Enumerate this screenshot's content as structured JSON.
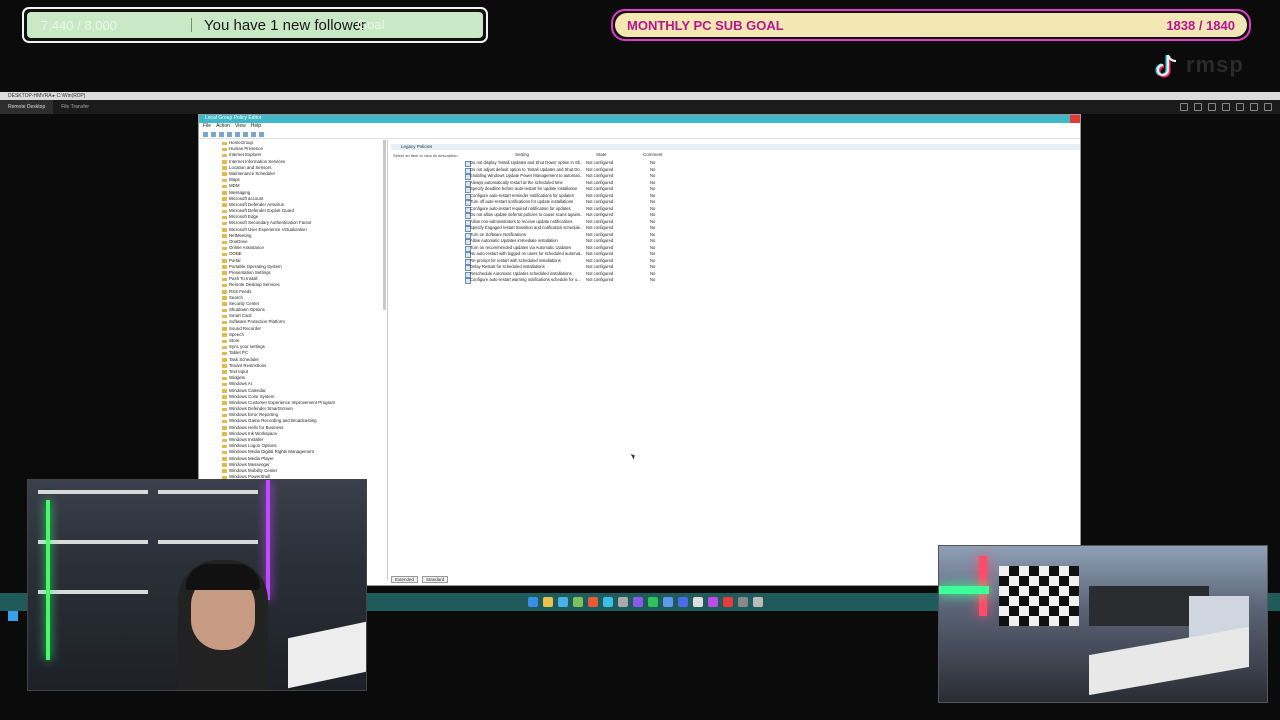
{
  "alert": {
    "ghost_left": "7,440 / 8,000",
    "message": "You have 1 new follower",
    "ghost_right": "Goal"
  },
  "goal": {
    "title": "MONTHLY PC SUB GOAL",
    "count": "1838 / 1840"
  },
  "brand": {
    "icon": "tiktok-icon",
    "text": "rmsp"
  },
  "remote_desktop": {
    "title": "DESKTOP-HMVRA ▸ C:\\Win(RDP)",
    "tabs": [
      "Remote Desktop",
      "File Transfer"
    ]
  },
  "gpedit": {
    "title": "Local Group Policy Editor",
    "menu": [
      "File",
      "Action",
      "View",
      "Help"
    ],
    "breadcrumb": "Legacy Policies",
    "hint": "Select an item to view its description.",
    "columns": {
      "setting": "Setting",
      "state": "State",
      "comment": "Comment"
    },
    "tree": [
      "HomeGroup",
      "Human Presence",
      "Internet Explorer",
      "Internet Information Services",
      "Location and Sensors",
      "Maintenance Scheduler",
      "Maps",
      "MDM",
      "Messaging",
      "Microsoft account",
      "Microsoft Defender Antivirus",
      "Microsoft Defender Exploit Guard",
      "Microsoft Edge",
      "Microsoft Secondary Authentication Factor",
      "Microsoft User Experience Virtualization",
      "NetMeeting",
      "OneDrive",
      "Online Assistance",
      "OOBE",
      "Portal",
      "Portable Operating System",
      "Presentation Settings",
      "Push To Install",
      "Remote Desktop Services",
      "RSS Feeds",
      "Search",
      "Security Center",
      "Shutdown Options",
      "Smart Card",
      "Software Protection Platform",
      "Sound Recorder",
      "Speech",
      "Store",
      "Sync your settings",
      "Tablet PC",
      "Task Scheduler",
      "Tenant Restrictions",
      "Text Input",
      "Widgets",
      "Windows AI",
      "Windows Calendar",
      "Windows Color System",
      "Windows Customer Experience Improvement Program",
      "Windows Defender SmartScreen",
      "Windows Error Reporting",
      "Windows Game Recording and Broadcasting",
      "Windows Hello for Business",
      "Windows Ink Workspace",
      "Windows Installer",
      "Windows Logon Options",
      "Windows Media Digital Rights Management",
      "Windows Media Player",
      "Windows Messenger",
      "Windows Mobility Center",
      "Windows PowerShell"
    ],
    "policies": [
      "Do not display 'Install Updates and Shut Down' option in Sh...",
      "Do not adjust default option to 'Install Updates and Shut Do...",
      "Enabling Windows Update Power Management to automati...",
      "Always automatically restart at the scheduled time",
      "Specify deadline before auto-restart for update installation",
      "Configure auto-restart reminder notifications for updates",
      "Turn off auto-restart notifications for update installations",
      "Configure auto-restart required notification for updates",
      "Do not allow update deferral policies to cause scans agains...",
      "Allow non-administrators to receive update notifications",
      "Specify Engaged restart transition and notification schedule...",
      "Turn on Software Notifications",
      "Allow Automatic Updates immediate installation",
      "Turn on recommended updates via Automatic Updates",
      "No auto-restart with logged on users for scheduled automat...",
      "Re-prompt for restart with scheduled installations",
      "Delay Restart for scheduled installations",
      "Reschedule Automatic Updates scheduled installations",
      "Configure auto-restart warning notifications schedule for u..."
    ],
    "policy_state": "Not configured",
    "policy_comment": "No",
    "tabs": [
      "Extended",
      "Standard"
    ]
  },
  "colors": {
    "goal_accent": "#b4168f",
    "goal_border": "#e13bcb",
    "alert_bg": "#c9e8c6",
    "taskbar": "#1f5b5b"
  }
}
